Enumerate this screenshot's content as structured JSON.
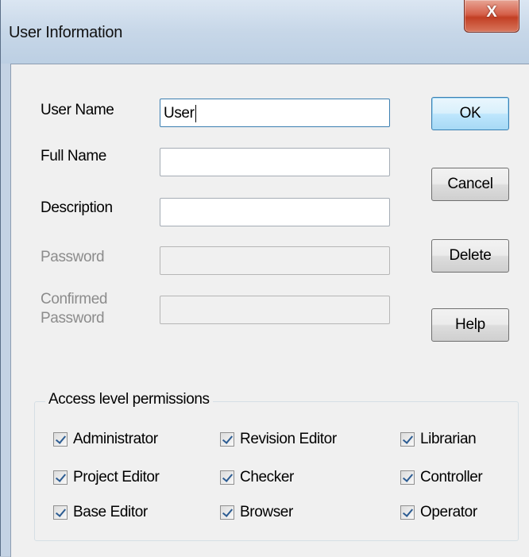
{
  "dialog": {
    "title": "User Information",
    "close_glyph": "X"
  },
  "fields": {
    "user_name": {
      "label": "User Name",
      "value": "User"
    },
    "full_name": {
      "label": "Full Name",
      "value": ""
    },
    "description": {
      "label": "Description",
      "value": ""
    },
    "password": {
      "label": "Password",
      "value": ""
    },
    "confirmed_password": {
      "label_line1": "Confirmed",
      "label_line2": "Password",
      "value": ""
    }
  },
  "buttons": {
    "ok": "OK",
    "cancel": "Cancel",
    "delete": "Delete",
    "help": "Help"
  },
  "permissions": {
    "title": "Access level permissions",
    "items": [
      {
        "label": "Administrator",
        "checked": true
      },
      {
        "label": "Revision Editor",
        "checked": true
      },
      {
        "label": "Librarian",
        "checked": true
      },
      {
        "label": "Project Editor",
        "checked": true
      },
      {
        "label": "Checker",
        "checked": true
      },
      {
        "label": "Controller",
        "checked": true
      },
      {
        "label": "Base Editor",
        "checked": true
      },
      {
        "label": "Browser",
        "checked": true
      },
      {
        "label": "Operator",
        "checked": true
      }
    ]
  },
  "icons": {
    "close": "close-icon",
    "checkbox": "checkmark-icon"
  }
}
